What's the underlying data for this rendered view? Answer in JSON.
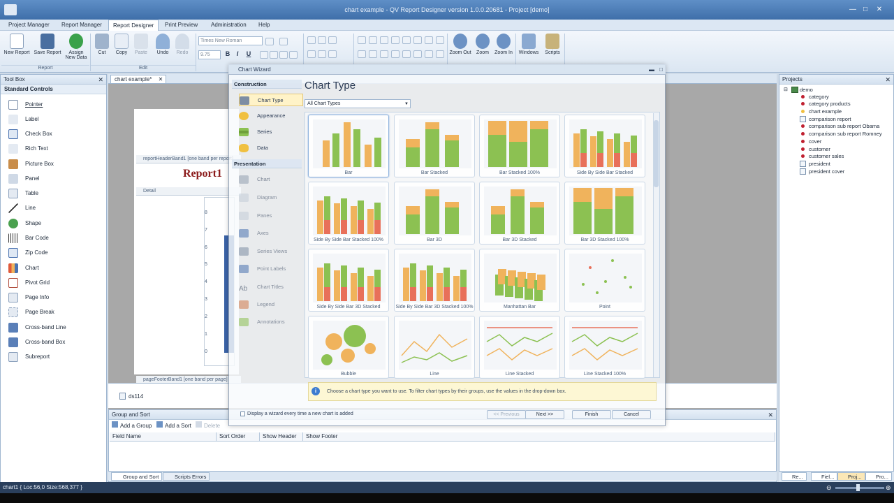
{
  "window": {
    "title": "chart example - QV Report Designer version 1.0.0.20681 - Project [demo]"
  },
  "menu": [
    "Project Manager",
    "Report Manager",
    "Report Designer",
    "Print Preview",
    "Administration",
    "Help"
  ],
  "ribbon": {
    "buttons": {
      "new_report": "New Report",
      "save_report": "Save Report",
      "assign": "Assign",
      "assign2": "New Data",
      "cut": "Cut",
      "copy": "Copy",
      "paste": "Paste",
      "undo": "Undo",
      "redo": "Redo",
      "zoom_out": "Zoom Out",
      "zoom": "Zoom",
      "zoom_in": "Zoom In",
      "windows": "Windows",
      "scripts": "Scripts"
    },
    "groups": {
      "report": "Report",
      "edit": "Edit"
    },
    "font_name": "Times New Roman",
    "font_size": "9.75",
    "format": {
      "bold": "B",
      "italic": "I",
      "underline": "U"
    }
  },
  "toolbox": {
    "title": "Tool Box",
    "section": "Standard Controls",
    "items": [
      "Pointer",
      "Label",
      "Check Box",
      "Rich Text",
      "Picture Box",
      "Panel",
      "Table",
      "Line",
      "Shape",
      "Bar Code",
      "Zip Code",
      "Chart",
      "Pivot Grid",
      "Page Info",
      "Page Break",
      "Cross-band Line",
      "Cross-band Box",
      "Subreport"
    ]
  },
  "designer": {
    "tab": "chart example*",
    "band_header": "reportHeaderBand1 [one band per report]",
    "band_detail": "Detail",
    "band_footer": "pageFooterBand1 [one band per page]",
    "report_title": "Report1",
    "y_ticks": [
      "8",
      "7",
      "6",
      "5",
      "4",
      "3",
      "2",
      "1",
      "0"
    ],
    "datasource": "ds114"
  },
  "group_sort": {
    "title": "Group and Sort",
    "buttons": {
      "add_group": "Add a Group",
      "add_sort": "Add a Sort",
      "delete": "Delete"
    },
    "columns": [
      "Field Name",
      "Sort Order",
      "Show Header",
      "Show Footer"
    ]
  },
  "bottom_tabs": [
    "Group and Sort",
    "Scripts Errors"
  ],
  "projects": {
    "title": "Projects",
    "root": "demo",
    "items": [
      "category",
      "category products",
      "chart example",
      "comparison report",
      "comparison sub report Obama",
      "comparison sub report Romney",
      "cover",
      "customer",
      "customer sales",
      "president",
      "president cover"
    ]
  },
  "project_tabs": [
    "Re...",
    "Fiel...",
    "Proj...",
    "Pro..."
  ],
  "status": {
    "text": "chart1 { Loc:56,0 Size:568,377 }"
  },
  "wizard": {
    "title": "Chart Wizard",
    "heading": "Chart Type",
    "filter": "All Chart Types",
    "nav": {
      "construction": "Construction",
      "construction_items": [
        "Chart Type",
        "Appearance",
        "Series",
        "Data"
      ],
      "presentation": "Presentation",
      "presentation_items": [
        "Chart",
        "Diagram",
        "Panes",
        "Axes",
        "Series Views",
        "Point Labels",
        "Chart Titles",
        "Legend",
        "Annotations"
      ]
    },
    "types": [
      "Bar",
      "Bar Stacked",
      "Bar Stacked 100%",
      "Side By Side Bar Stacked",
      "Side By Side Bar Stacked 100%",
      "Bar 3D",
      "Bar 3D Stacked",
      "Bar 3D Stacked 100%",
      "Side By Side Bar 3D Stacked",
      "Side By Side Bar 3D Stacked 100%",
      "Manhattan Bar",
      "Point",
      "Bubble",
      "Line",
      "Line Stacked",
      "Line Stacked 100%"
    ],
    "hint": "Choose a chart type you want to use. To filter chart types by their groups, use the values in the drop-down box.",
    "footer_check": "Display a wizard every time a new chart is added",
    "buttons": {
      "previous": "<< Previous",
      "next": "Next >>",
      "finish": "Finish",
      "cancel": "Cancel"
    }
  },
  "colors": {
    "orange": "#f0b35c",
    "green": "#8cc152",
    "red": "#e8705a",
    "accent": "#3f6fa9"
  }
}
